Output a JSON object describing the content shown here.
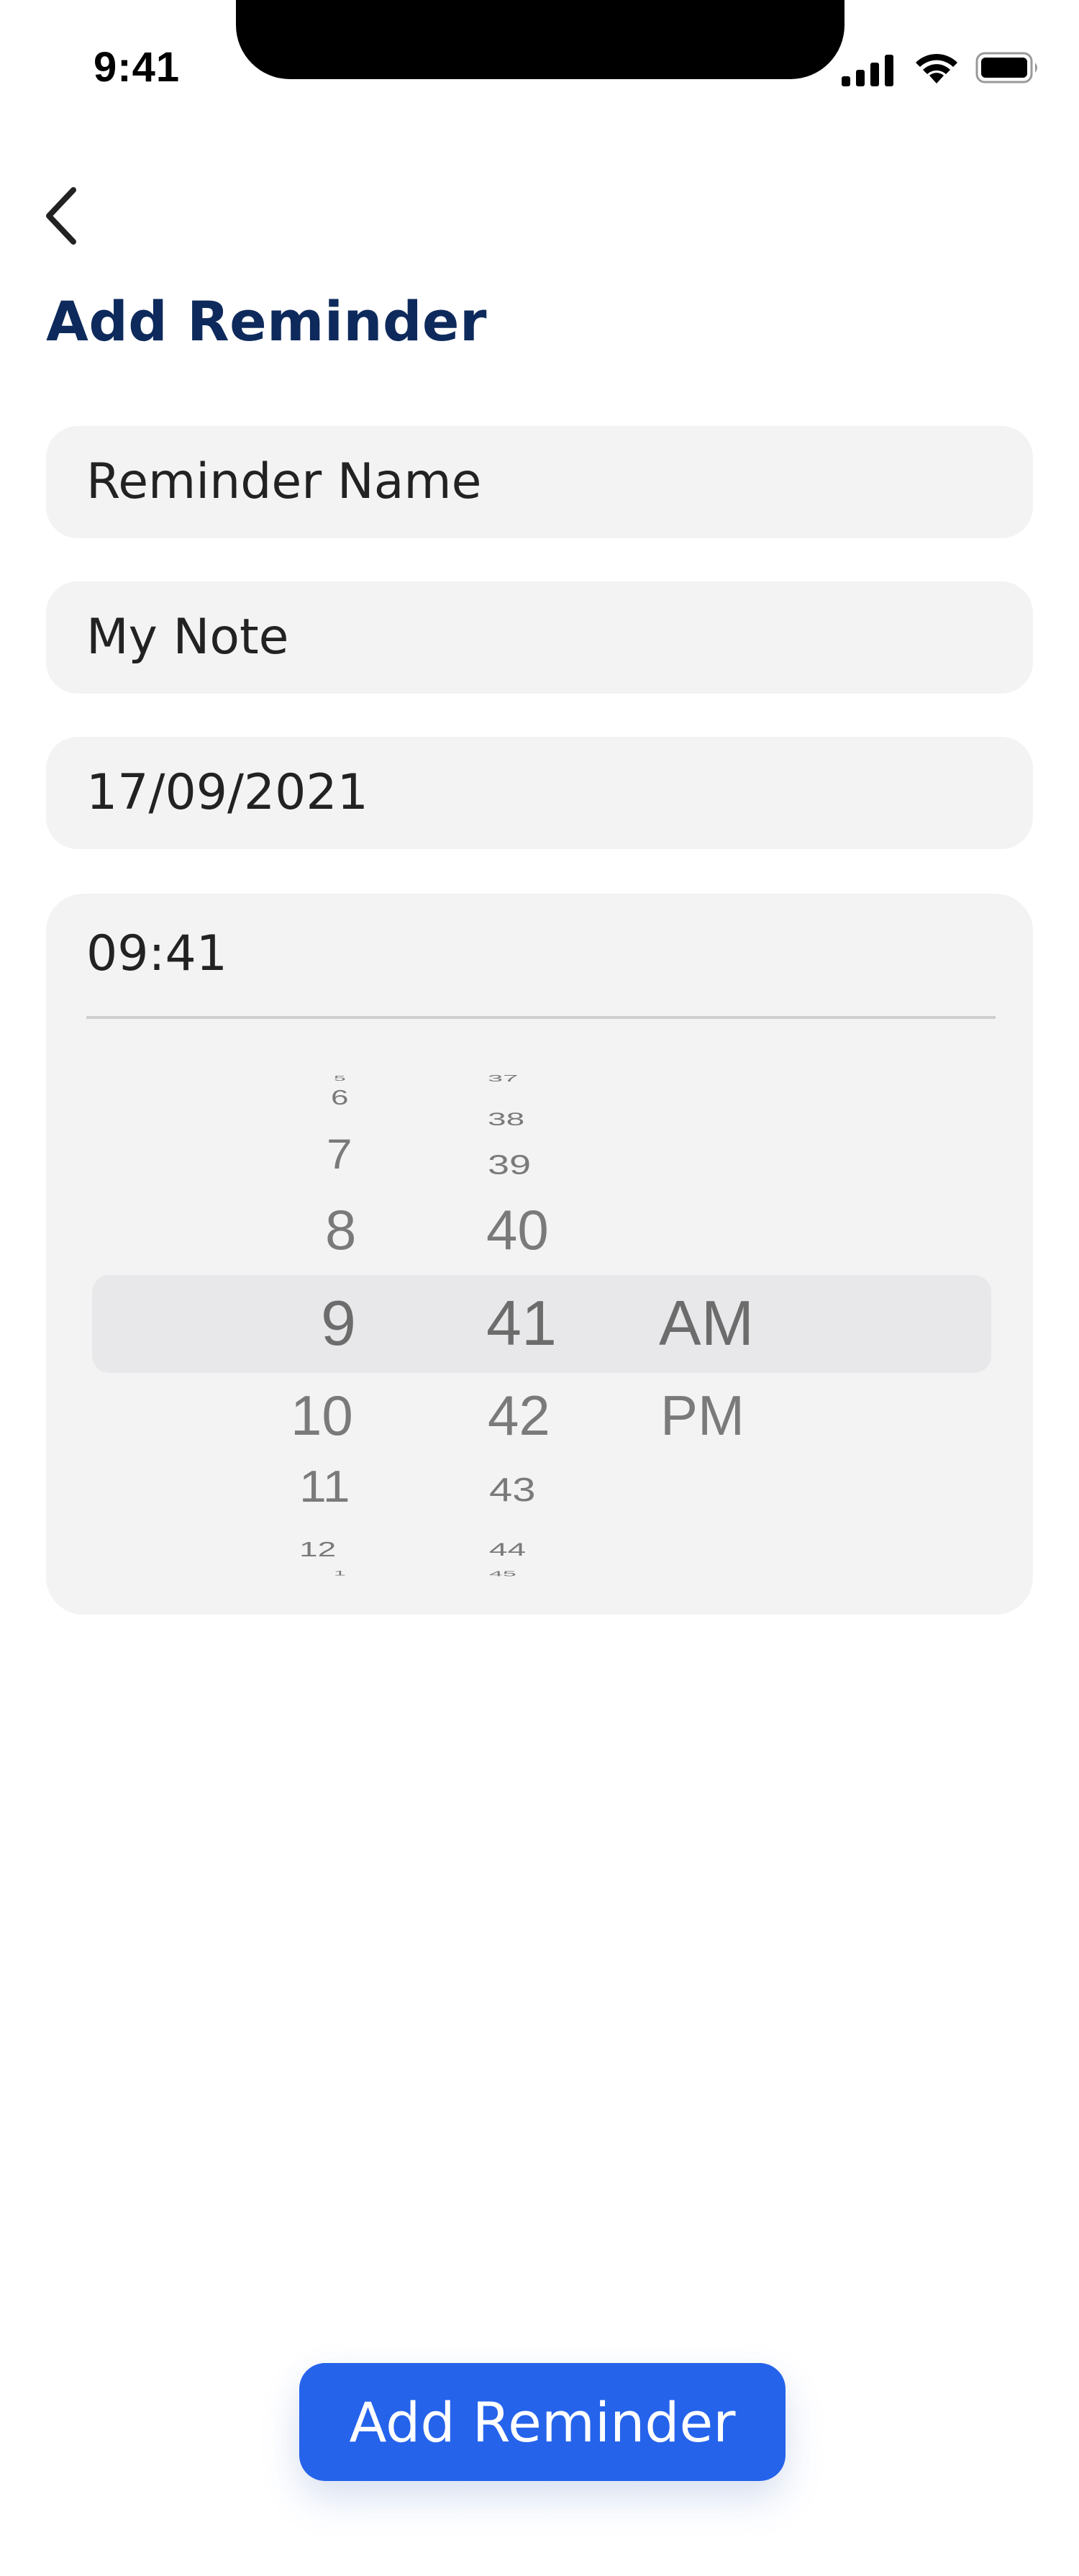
{
  "status_bar": {
    "time": "9:41",
    "icons": [
      "cellular-signal-icon",
      "wifi-icon",
      "battery-icon"
    ]
  },
  "header": {
    "back_icon": "chevron-left-icon",
    "title": "Add Reminder"
  },
  "form": {
    "reminder_name": "Reminder Name",
    "note": "My Note",
    "date": "17/09/2021",
    "time": "09:41"
  },
  "time_picker": {
    "hours_above": [
      "5",
      "6",
      "7",
      "8"
    ],
    "hour_selected": "9",
    "hours_below": [
      "10",
      "11",
      "12",
      "1"
    ],
    "minutes_above": [
      "37",
      "38",
      "39",
      "40"
    ],
    "minute_selected": "41",
    "minutes_below": [
      "42",
      "43",
      "44",
      "45"
    ],
    "period_selected": "AM",
    "period_other": "PM"
  },
  "actions": {
    "add_button_label": "Add Reminder"
  },
  "colors": {
    "title": "#0e2a5c",
    "accent": "#2563eb",
    "field_background": "#f3f3f3"
  }
}
